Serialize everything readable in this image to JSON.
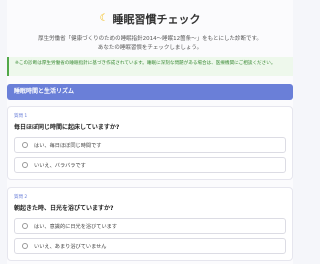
{
  "header": {
    "title": "睡眠習慣チェック",
    "intro_line1": "厚生労働省「健康づくりのための睡眠指針2014〜睡眠12箇条〜」をもとにした診断です。",
    "intro_line2": "あなたの睡眠習慣をチェックしましょう。"
  },
  "notice": {
    "text": "※この診断は厚生労働省の睡眠指針に基づき作成されています。睡眠に深刻な問題がある場合は、医療機関にご相談ください。"
  },
  "section": {
    "title": "睡眠時間と生活リズム"
  },
  "questions": [
    {
      "number": "質問 1",
      "text": "毎日ほぼ同じ時間に起床していますか?",
      "options": [
        "はい、毎日ほぼ同じ時間です",
        "いいえ、バラバラです"
      ]
    },
    {
      "number": "質問 2",
      "text": "朝起きた時、日光を浴びていますか?",
      "options": [
        "はい、意識的に日光を浴びています",
        "いいえ、あまり浴びていません"
      ]
    }
  ]
}
